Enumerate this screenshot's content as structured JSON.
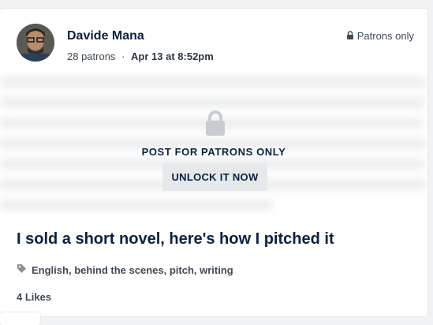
{
  "post": {
    "author": "Davide Mana",
    "patrons": "28 patrons",
    "separator": "·",
    "date": "Apr 13 at 8:52pm",
    "visibility": "Patrons only",
    "gate_text": "POST FOR PATRONS ONLY",
    "unlock_label": "UNLOCK IT NOW",
    "title": "I sold a short novel, here's how I pitched it",
    "tags": [
      "English",
      "behind the scenes",
      "pitch",
      "writing"
    ],
    "likes": "4 Likes"
  },
  "colors": {
    "text_primary": "#0b2140",
    "text_secondary": "#3f4a55",
    "button_bg": "#e6e9ec",
    "page_bg": "#f1f2f3",
    "icon_gray": "#8a929a",
    "lock_gray": "#c7ccd1"
  }
}
